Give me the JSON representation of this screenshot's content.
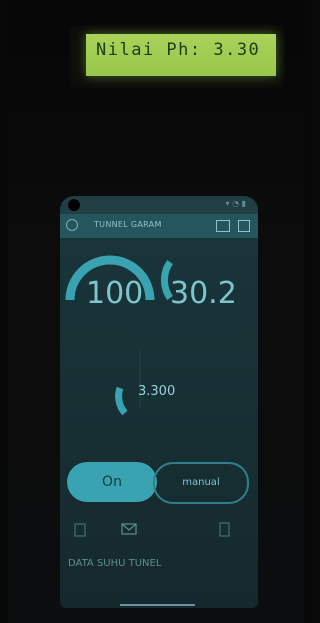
{
  "lcd": {
    "text": "Nilai Ph: 3.30"
  },
  "app": {
    "title": "TUNNEL GARAM",
    "gauge1_value": "100",
    "gauge2_value": "30.2",
    "ph_value": "3.300",
    "on_button": "On",
    "manual_button": "manual",
    "section_title": "DATA SUHU TUNEL"
  },
  "colors": {
    "accent": "#3aa3b1",
    "lcd_green": "#a9d35a",
    "background": "#0a0a0a"
  }
}
